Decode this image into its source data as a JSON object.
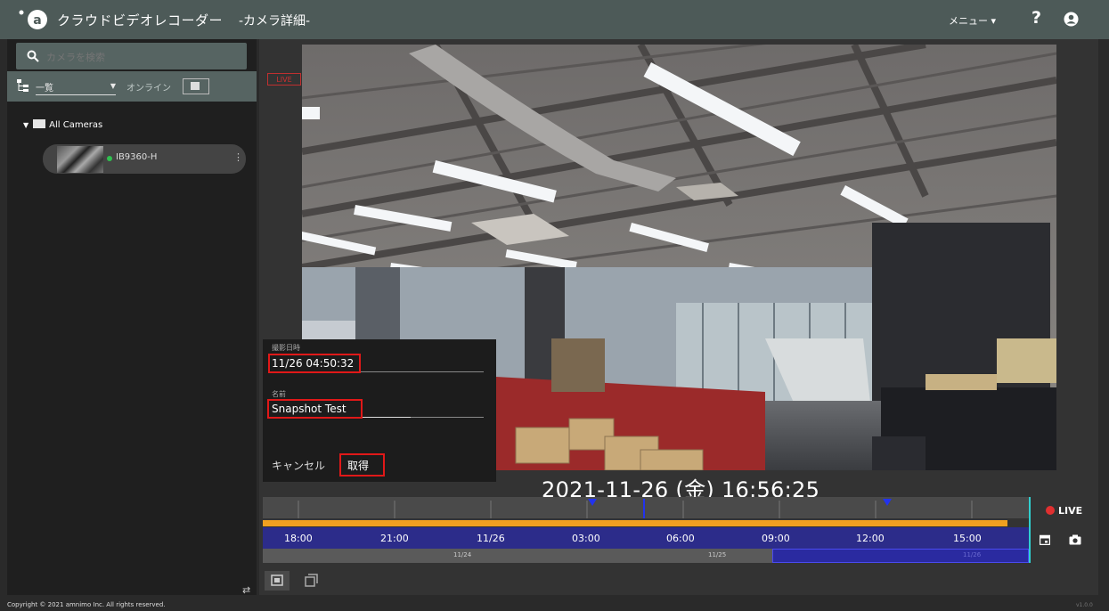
{
  "header": {
    "app_title": "クラウドビデオレコーダー",
    "page_subtitle": "-カメラ詳細-",
    "menu_label": "メニュー ▾",
    "help_label": "?"
  },
  "sidebar": {
    "search_placeholder": "カメラを検索",
    "view_select": "一覧",
    "online_label": "オンライン",
    "folder_label": "All Cameras",
    "cameras": [
      {
        "name": "IB9360-H",
        "status": "online"
      }
    ],
    "more_label": "⋮",
    "footer_icon": "⇄"
  },
  "player": {
    "live_tag": "LIVE",
    "datetime": "2021-11-26 (金) 16:56:25",
    "live_button": "LIVE"
  },
  "snapshot_dialog": {
    "time_label": "撮影日時",
    "time_value": "11/26 04:50:32",
    "name_label": "名前",
    "name_value": "Snapshot Test",
    "cancel_label": "キャンセル",
    "save_label": "取得"
  },
  "timeline": {
    "hour_labels": [
      "18:00",
      "21:00",
      "11/26",
      "03:00",
      "06:00",
      "09:00",
      "12:00",
      "15:00"
    ],
    "day_labels": [
      "11/24",
      "11/25",
      "11/26"
    ]
  },
  "footer": {
    "copyright": "Copyright © 2021 amnimo Inc. All rights reserved.",
    "version": "v1.0.0"
  },
  "colors": {
    "header_bg": "#4d5a58",
    "timeline_bar": "#2c2c8a",
    "recording_band": "#f0a020",
    "highlight": "#e01818",
    "online": "#30c050"
  }
}
